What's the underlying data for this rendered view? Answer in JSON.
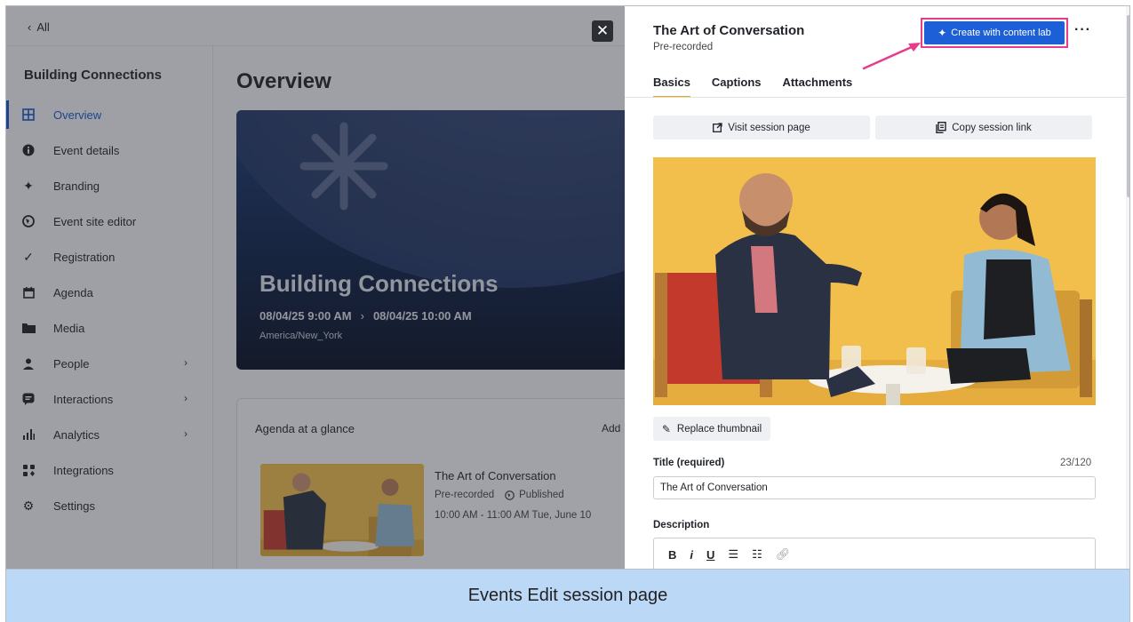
{
  "caption": "Events Edit session page",
  "topbar": {
    "back_label": "All",
    "back_icon": "chevron-left-icon"
  },
  "sidebar": {
    "event_name": "Building Connections",
    "items": [
      {
        "label": "Overview",
        "icon": "grid-icon",
        "active": true
      },
      {
        "label": "Event details",
        "icon": "info-icon"
      },
      {
        "label": "Branding",
        "icon": "sparkle-icon"
      },
      {
        "label": "Event site editor",
        "icon": "globe-icon"
      },
      {
        "label": "Registration",
        "icon": "check-icon"
      },
      {
        "label": "Agenda",
        "icon": "calendar-icon"
      },
      {
        "label": "Media",
        "icon": "folder-icon"
      },
      {
        "label": "People",
        "icon": "person-icon",
        "has_submenu": true
      },
      {
        "label": "Interactions",
        "icon": "chat-icon",
        "has_submenu": true
      },
      {
        "label": "Analytics",
        "icon": "bar-chart-icon",
        "has_submenu": true
      },
      {
        "label": "Integrations",
        "icon": "integrations-icon"
      },
      {
        "label": "Settings",
        "icon": "gear-icon"
      }
    ]
  },
  "main": {
    "title": "Overview",
    "hero": {
      "title": "Building Connections",
      "start": "08/04/25 9:00 AM",
      "end": "08/04/25 10:00 AM",
      "timezone": "America/New_York"
    },
    "agenda": {
      "heading": "Agenda at a glance",
      "add_label": "Add",
      "item": {
        "title": "The Art of Conversation",
        "type": "Pre-recorded",
        "status": "Published",
        "time": "10:00 AM - 11:00 AM Tue, June 10"
      }
    }
  },
  "panel": {
    "title": "The Art of Conversation",
    "subtitle": "Pre-recorded",
    "content_lab_label": "Create with content lab",
    "more_label": "···",
    "tabs": [
      {
        "label": "Basics",
        "active": true
      },
      {
        "label": "Captions"
      },
      {
        "label": "Attachments"
      }
    ],
    "visit_label": "Visit session page",
    "copy_label": "Copy session link",
    "replace_label": "Replace thumbnail",
    "title_field": {
      "label": "Title (required)",
      "count": "23/120",
      "value": "The Art of Conversation"
    },
    "description_label": "Description",
    "toolbar": {
      "bold": "B",
      "italic": "i",
      "underline": "U"
    }
  },
  "colors": {
    "accent": "#1556c4",
    "button_primary": "#1d5fd6",
    "highlight": "#e53d8a",
    "tab_underline": "#e2a520",
    "caption_bg": "#bcd8f7"
  }
}
